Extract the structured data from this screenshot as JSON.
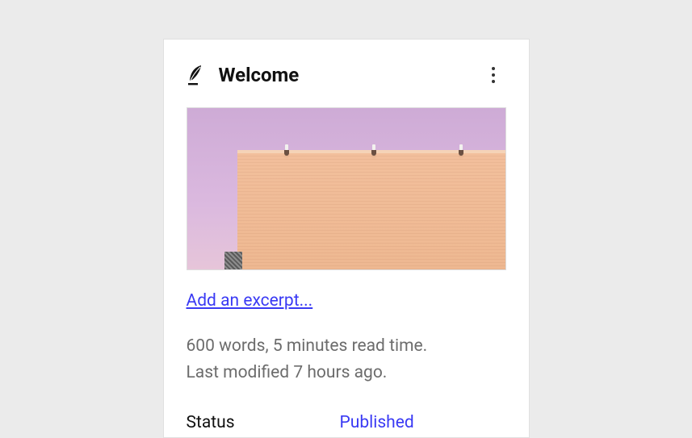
{
  "card": {
    "title": "Welcome",
    "excerpt_link": "Add an excerpt...",
    "meta_words": "600 words, 5 minutes read time.",
    "meta_modified": "Last modified 7 hours ago.",
    "status_label": "Status",
    "status_value": "Published"
  }
}
